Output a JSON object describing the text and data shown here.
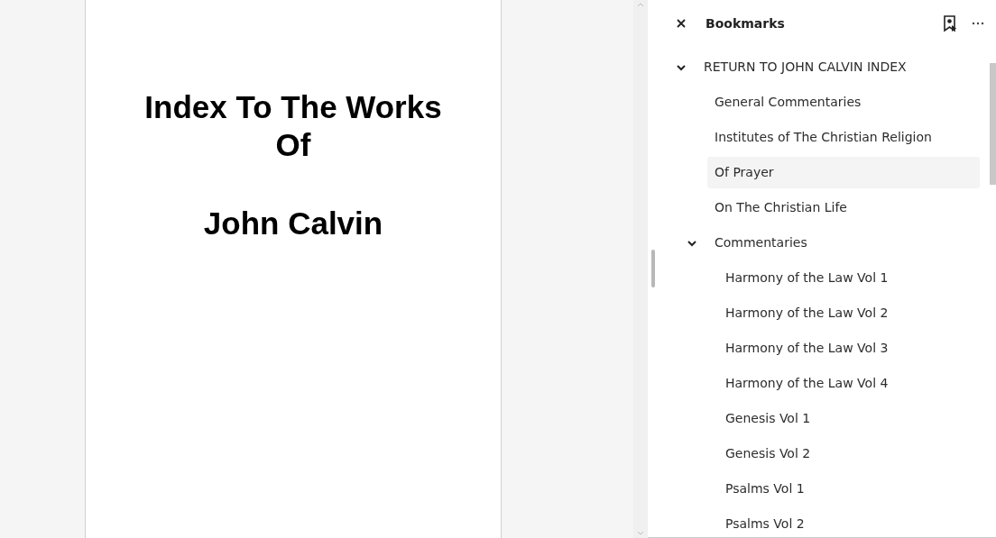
{
  "document": {
    "title_lines": [
      "Index To The Works",
      "Of"
    ],
    "subtitle": "John Calvin"
  },
  "bookmarks": {
    "title": "Bookmarks",
    "items": [
      {
        "label": "RETURN TO JOHN CALVIN INDEX",
        "selected": false,
        "expanded": true,
        "children": [
          {
            "label": "General Commentaries",
            "selected": false
          },
          {
            "label": "Institutes of The Christian Religion",
            "selected": false
          },
          {
            "label": "Of Prayer",
            "selected": true
          },
          {
            "label": "On The Christian Life",
            "selected": false
          },
          {
            "label": "Commentaries",
            "selected": false,
            "expanded": true,
            "children": [
              {
                "label": "Harmony of the Law Vol 1",
                "selected": false
              },
              {
                "label": "Harmony of the Law Vol 2",
                "selected": false
              },
              {
                "label": "Harmony of the Law Vol 3",
                "selected": false
              },
              {
                "label": "Harmony of the Law Vol 4",
                "selected": false
              },
              {
                "label": "Genesis Vol 1",
                "selected": false
              },
              {
                "label": "Genesis Vol 2",
                "selected": false
              },
              {
                "label": "Psalms Vol 1",
                "selected": false
              },
              {
                "label": "Psalms Vol 2",
                "selected": false
              }
            ]
          }
        ]
      }
    ]
  }
}
